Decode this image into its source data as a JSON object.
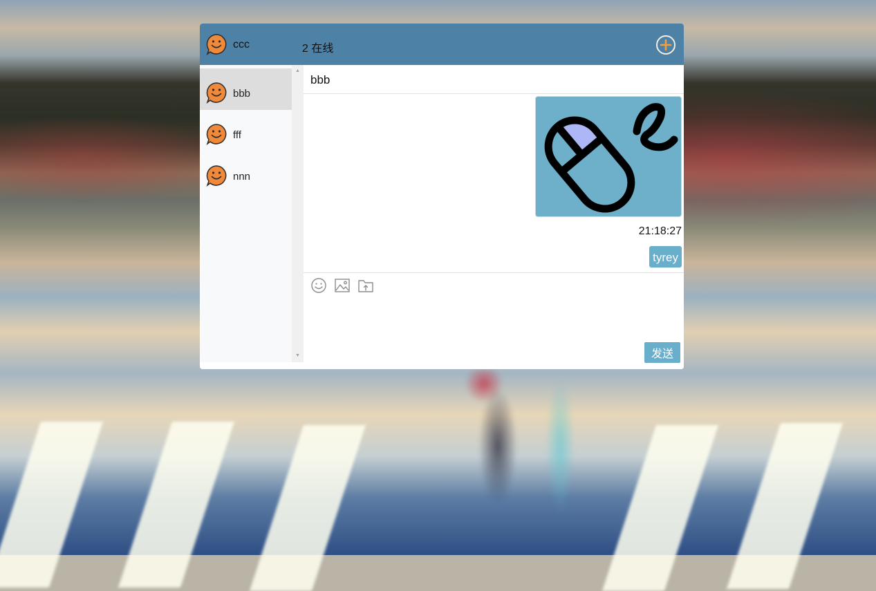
{
  "header": {
    "username": "ccc",
    "online_status": "2 在线"
  },
  "contacts": [
    {
      "name": "bbb",
      "active": true
    },
    {
      "name": "fff",
      "active": false
    },
    {
      "name": "nnn",
      "active": false
    }
  ],
  "conversation": {
    "title": "bbb",
    "messages": [
      {
        "type": "image",
        "icon": "mouse-icon"
      },
      {
        "type": "time",
        "text": "21:18:27"
      },
      {
        "type": "text",
        "text": "tyrey"
      }
    ]
  },
  "composer": {
    "tools": [
      "emoji-icon",
      "image-icon",
      "file-upload-icon"
    ],
    "send_label": "发送"
  },
  "colors": {
    "header_bg": "#4e81a6",
    "accent": "#69aecb",
    "avatar": "#f08a3a"
  }
}
